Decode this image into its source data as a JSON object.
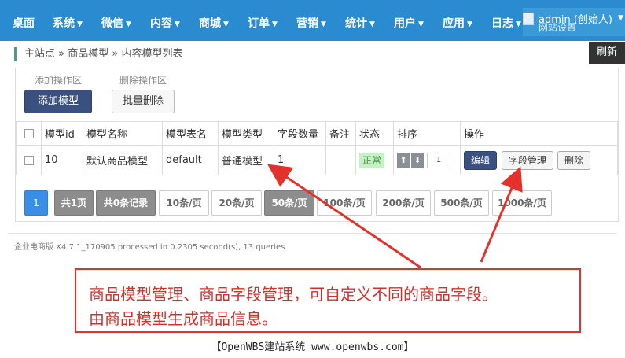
{
  "nav": {
    "items": [
      {
        "label": "桌面",
        "caret": false
      },
      {
        "label": "系统",
        "caret": true
      },
      {
        "label": "微信",
        "caret": true
      },
      {
        "label": "内容",
        "caret": true
      },
      {
        "label": "商城",
        "caret": true
      },
      {
        "label": "订单",
        "caret": true
      },
      {
        "label": "营销",
        "caret": true
      },
      {
        "label": "统计",
        "caret": true
      },
      {
        "label": "用户",
        "caret": true
      },
      {
        "label": "应用",
        "caret": true
      },
      {
        "label": "日志",
        "caret": true
      }
    ],
    "user_name": "admin (创始人)",
    "user_bg_text": "网站设置"
  },
  "breadcrumb": {
    "root": "主站点",
    "sep": "»",
    "level1": "商品模型",
    "level2": "内容模型列表"
  },
  "refresh_label": "刷新",
  "toolbar": {
    "add_group_label": "添加操作区",
    "delete_group_label": "删除操作区",
    "add_button": "添加模型",
    "batch_delete_button": "批量删除"
  },
  "table": {
    "headers": [
      "模型id",
      "模型名称",
      "模型表名",
      "模型类型",
      "字段数量",
      "备注",
      "状态",
      "排序",
      "操作"
    ],
    "rows": [
      {
        "id": "10",
        "name": "默认商品模型",
        "table_name": "default",
        "type": "普通模型",
        "field_count": "1",
        "remark": "",
        "status": "正常",
        "sort": "1",
        "actions": {
          "edit": "编辑",
          "fields": "字段管理",
          "delete": "删除"
        }
      }
    ]
  },
  "pagination": {
    "current": "1",
    "total_pages": "共1页",
    "total_records": "共0条记录",
    "page_sizes": [
      "10条/页",
      "20条/页",
      "50条/页",
      "100条/页",
      "200条/页",
      "500条/页",
      "1000条/页"
    ],
    "selected_size": "50条/页"
  },
  "footer": "企业电商版 X4.7.1_170905 processed in 0.2305 second(s), 13 queries",
  "annotation": {
    "line1": "商品模型管理、商品字段管理，可自定义不同的商品字段。",
    "line2": "由商品模型生成商品信息。",
    "color": "#e3322c"
  },
  "caption": "【OpenWBS建站系统 www.openwbs.com】",
  "colors": {
    "nav_bg": "#2b8bd1",
    "primary": "#3a5180",
    "page_active": "#3a8ee6"
  }
}
